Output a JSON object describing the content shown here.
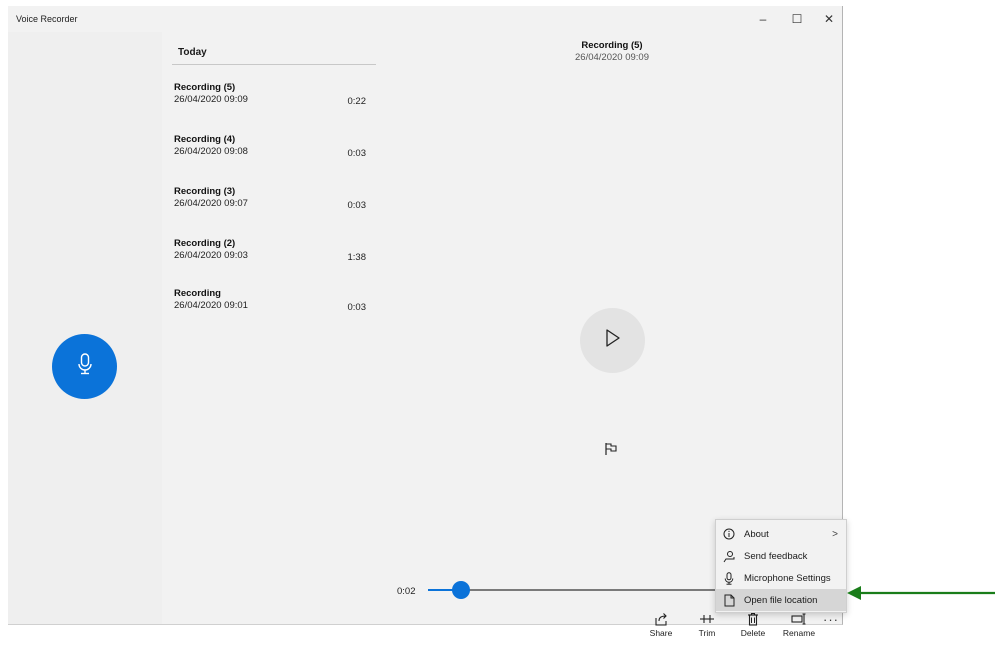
{
  "window": {
    "title": "Voice Recorder",
    "controls": {
      "minimize": "–",
      "maximize": "☐",
      "close": "✕"
    }
  },
  "recordings": {
    "group_header": "Today",
    "items": [
      {
        "name": "Recording (5)",
        "date": "26/04/2020 09:09",
        "duration": "0:22"
      },
      {
        "name": "Recording (4)",
        "date": "26/04/2020 09:08",
        "duration": "0:03"
      },
      {
        "name": "Recording (3)",
        "date": "26/04/2020 09:07",
        "duration": "0:03"
      },
      {
        "name": "Recording (2)",
        "date": "26/04/2020 09:03",
        "duration": "1:38"
      },
      {
        "name": "Recording",
        "date": "26/04/2020 09:01",
        "duration": "0:03"
      }
    ]
  },
  "detail": {
    "title": "Recording (5)",
    "date": "26/04/2020 09:09"
  },
  "playback": {
    "elapsed": "0:02",
    "progress": 0.1
  },
  "commands": {
    "share": "Share",
    "trim": "Trim",
    "delete": "Delete",
    "rename": "Rename",
    "more": "···"
  },
  "menu": {
    "items": [
      {
        "label": "About",
        "icon": "info-icon",
        "has_submenu": true,
        "chevron": ">"
      },
      {
        "label": "Send feedback",
        "icon": "feedback-icon"
      },
      {
        "label": "Microphone Settings",
        "icon": "microphone-icon"
      },
      {
        "label": "Open file location",
        "icon": "file-icon",
        "highlighted": true
      }
    ]
  },
  "colors": {
    "accent": "#0b73d9",
    "annotation_arrow": "#1a7d1a"
  }
}
